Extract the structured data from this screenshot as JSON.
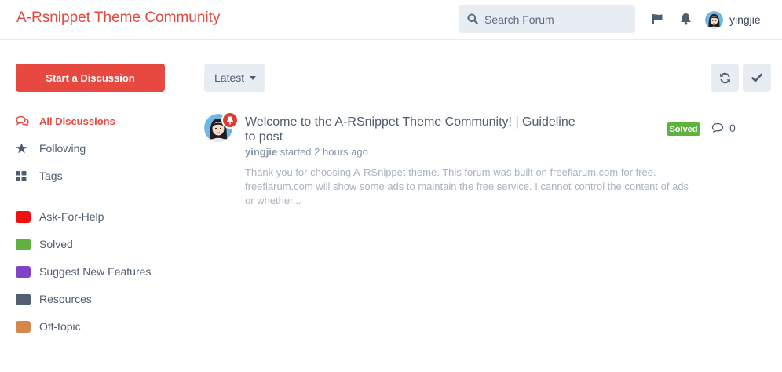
{
  "header": {
    "brand": "A-Rsnippet Theme Community",
    "search_placeholder": "Search Forum",
    "user_name": "yingjie"
  },
  "sidebar": {
    "start_button": "Start a Discussion",
    "nav": [
      {
        "label": "All Discussions",
        "icon": "comments-icon"
      },
      {
        "label": "Following",
        "icon": "star-icon"
      },
      {
        "label": "Tags",
        "icon": "tags-grid-icon"
      }
    ],
    "tags": [
      {
        "label": "Ask-For-Help",
        "color": "#ee1111"
      },
      {
        "label": "Solved",
        "color": "#5eb23d"
      },
      {
        "label": "Suggest New Features",
        "color": "#8142c8"
      },
      {
        "label": "Resources",
        "color": "#525f70"
      },
      {
        "label": "Off-topic",
        "color": "#d6874a"
      }
    ]
  },
  "toolbar": {
    "sort_label": "Latest"
  },
  "discussion": {
    "title": "Welcome to the A-RSnippet Theme Community! | Guideline to post",
    "author": "yingjie",
    "meta": " started 2 hours ago",
    "excerpt": "Thank you for choosing A-RSnippet theme. This forum was built on freeflarum.com for free. freeflarum.com will show some ads to maintain the free service. I cannot control the content of ads or whether...",
    "badge": "Solved",
    "reply_count": "0"
  },
  "colors": {
    "accent": "#e7483f",
    "control_bg": "#e8ecf3"
  }
}
